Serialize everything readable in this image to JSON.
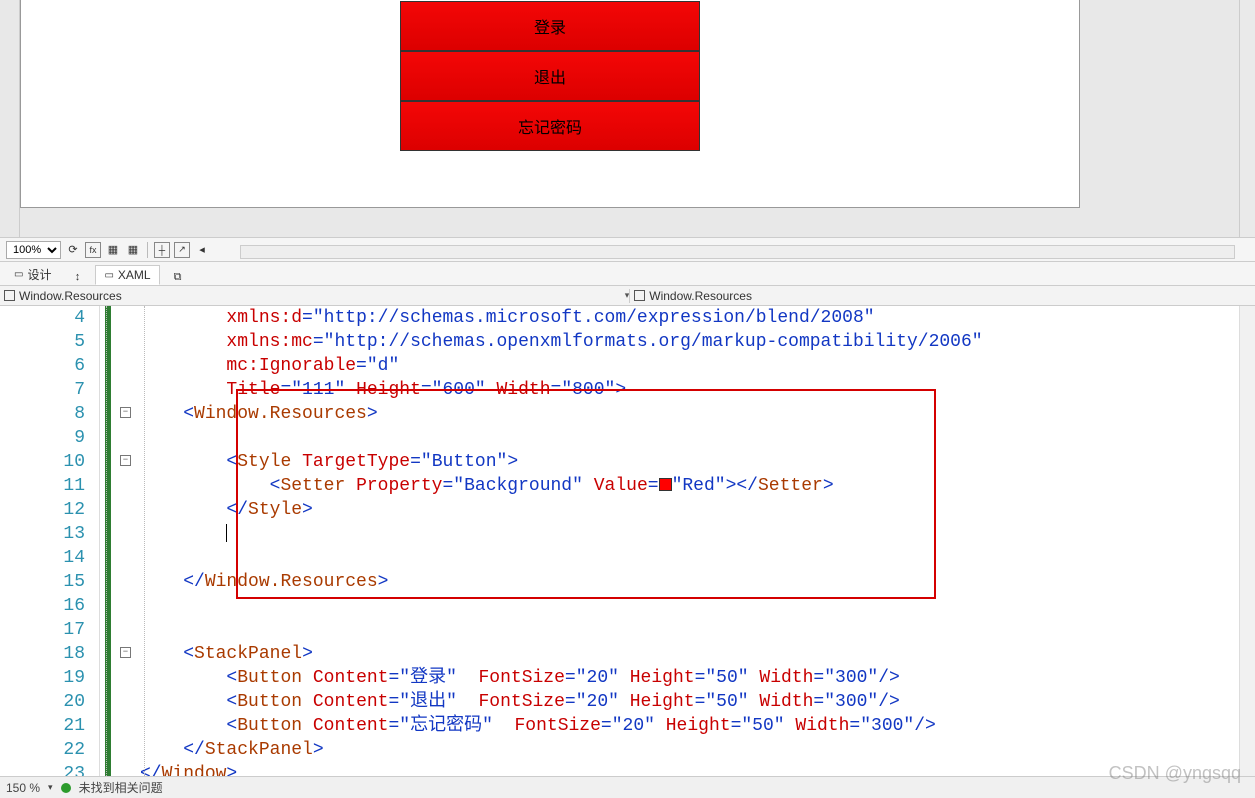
{
  "designer": {
    "buttons": [
      "登录",
      "退出",
      "忘记密码"
    ]
  },
  "toolbar": {
    "zoom": "100%",
    "design_tab": "设计",
    "xaml_tab": "XAML"
  },
  "crumbs": {
    "left": "Window.Resources",
    "right": "Window.Resources"
  },
  "lines": {
    "4": {
      "indent": "        ",
      "pre": "xmlns:d",
      "url": "http://schemas.microsoft.com/expression/blend/2008"
    },
    "5": {
      "indent": "        ",
      "pre": "xmlns:mc",
      "url": "http://schemas.openxmlformats.org/markup-compatibility/2006"
    },
    "6": {
      "indent": "        ",
      "pre": "mc:Ignorable",
      "val": "d"
    },
    "7": {
      "indent": "        ",
      "title": "111",
      "height": "600",
      "width": "800"
    },
    "8": {
      "indent": "    ",
      "open": "Window.Resources"
    },
    "10": {
      "indent": "        ",
      "tag": "Style",
      "attr": "TargetType",
      "val": "Button"
    },
    "11": {
      "indent": "            ",
      "tag": "Setter",
      "a1": "Property",
      "v1": "Background",
      "a2": "Value",
      "v2": "Red",
      "close": "Setter"
    },
    "12": {
      "indent": "        ",
      "close": "Style"
    },
    "15": {
      "indent": "    ",
      "close": "Window.Resources"
    },
    "18": {
      "indent": "    ",
      "open": "StackPanel"
    },
    "19": {
      "indent": "        ",
      "content": "登录",
      "fs": "20",
      "h": "50",
      "w": "300"
    },
    "20": {
      "indent": "        ",
      "content": "退出",
      "fs": "20",
      "h": "50",
      "w": "300"
    },
    "21": {
      "indent": "        ",
      "content": "忘记密码",
      "fs": "20",
      "h": "50",
      "w": "300"
    },
    "22": {
      "indent": "    ",
      "close": "StackPanel"
    },
    "23": {
      "indent": "",
      "close": "Window"
    }
  },
  "bottom": {
    "zoom2": "150 %",
    "issues": "未找到相关问题"
  },
  "watermark": "CSDN @yngsqq"
}
